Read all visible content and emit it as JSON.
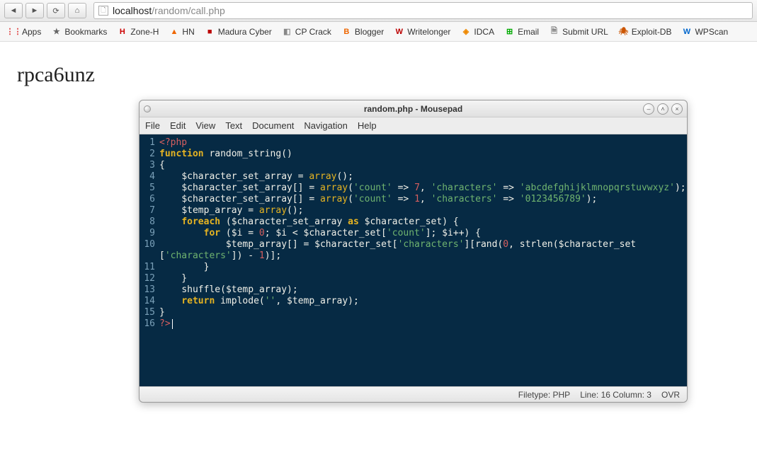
{
  "browser": {
    "nav": {
      "back": "◄",
      "forward": "►",
      "reload": "⟳",
      "home": "⌂",
      "doc": "🗋"
    },
    "url": {
      "host": "localhost",
      "path": "/random/call.php"
    }
  },
  "bookmarks": [
    {
      "icon": "⋮⋮",
      "color": "#d33",
      "label": "Apps"
    },
    {
      "icon": "★",
      "color": "#666",
      "label": "Bookmarks"
    },
    {
      "icon": "H",
      "color": "#c00",
      "label": "Zone-H"
    },
    {
      "icon": "▲",
      "color": "#e60",
      "label": "HN"
    },
    {
      "icon": "■",
      "color": "#b00",
      "label": "Madura Cyber"
    },
    {
      "icon": "◧",
      "color": "#888",
      "label": "CP Crack"
    },
    {
      "icon": "B",
      "color": "#e60",
      "label": "Blogger"
    },
    {
      "icon": "W",
      "color": "#b00",
      "label": "Writelonger"
    },
    {
      "icon": "◈",
      "color": "#e80",
      "label": "IDCA"
    },
    {
      "icon": "⊞",
      "color": "#0a0",
      "label": "Email"
    },
    {
      "icon": "🗎",
      "color": "#888",
      "label": "Submit URL"
    },
    {
      "icon": "🕷",
      "color": "#c50",
      "label": "Exploit-DB"
    },
    {
      "icon": "W",
      "color": "#06c",
      "label": "WPScan"
    }
  ],
  "page": {
    "output": "rpca6unz"
  },
  "editor": {
    "title": "random.php - Mousepad",
    "menu": [
      "File",
      "Edit",
      "View",
      "Text",
      "Document",
      "Navigation",
      "Help"
    ],
    "status": {
      "filetype_label": "Filetype:",
      "filetype": "PHP",
      "pos_label": "Line:",
      "line": "16",
      "col_label": "Column:",
      "col": "3",
      "mode": "OVR"
    },
    "code": [
      [
        [
          "tag",
          "<?php"
        ]
      ],
      [
        [
          "kw",
          "function"
        ],
        [
          "p",
          " "
        ],
        [
          "fn",
          "random_string"
        ],
        [
          "p",
          "()"
        ]
      ],
      [
        [
          "p",
          "{"
        ]
      ],
      [
        [
          "p",
          "    "
        ],
        [
          "var",
          "$character_set_array"
        ],
        [
          "p",
          " "
        ],
        [
          "op",
          "="
        ],
        [
          "p",
          " "
        ],
        [
          "arr",
          "array"
        ],
        [
          "p",
          "();"
        ]
      ],
      [
        [
          "p",
          "    "
        ],
        [
          "var",
          "$character_set_array"
        ],
        [
          "p",
          "[] "
        ],
        [
          "op",
          "="
        ],
        [
          "p",
          " "
        ],
        [
          "arr",
          "array"
        ],
        [
          "p",
          "("
        ],
        [
          "str",
          "'count'"
        ],
        [
          "p",
          " "
        ],
        [
          "op",
          "=>"
        ],
        [
          "p",
          " "
        ],
        [
          "num",
          "7"
        ],
        [
          "p",
          ", "
        ],
        [
          "str",
          "'characters'"
        ],
        [
          "p",
          " "
        ],
        [
          "op",
          "=>"
        ],
        [
          "p",
          " "
        ],
        [
          "str",
          "'abcdefghijklmnopqrstuvwxyz'"
        ],
        [
          "p",
          ");"
        ]
      ],
      [
        [
          "p",
          "    "
        ],
        [
          "var",
          "$character_set_array"
        ],
        [
          "p",
          "[] "
        ],
        [
          "op",
          "="
        ],
        [
          "p",
          " "
        ],
        [
          "arr",
          "array"
        ],
        [
          "p",
          "("
        ],
        [
          "str",
          "'count'"
        ],
        [
          "p",
          " "
        ],
        [
          "op",
          "=>"
        ],
        [
          "p",
          " "
        ],
        [
          "num",
          "1"
        ],
        [
          "p",
          ", "
        ],
        [
          "str",
          "'characters'"
        ],
        [
          "p",
          " "
        ],
        [
          "op",
          "=>"
        ],
        [
          "p",
          " "
        ],
        [
          "str",
          "'0123456789'"
        ],
        [
          "p",
          ");"
        ]
      ],
      [
        [
          "p",
          "    "
        ],
        [
          "var",
          "$temp_array"
        ],
        [
          "p",
          " "
        ],
        [
          "op",
          "="
        ],
        [
          "p",
          " "
        ],
        [
          "arr",
          "array"
        ],
        [
          "p",
          "();"
        ]
      ],
      [
        [
          "p",
          "    "
        ],
        [
          "kw",
          "foreach"
        ],
        [
          "p",
          " ("
        ],
        [
          "var",
          "$character_set_array"
        ],
        [
          "p",
          " "
        ],
        [
          "kw",
          "as"
        ],
        [
          "p",
          " "
        ],
        [
          "var",
          "$character_set"
        ],
        [
          "p",
          ") {"
        ]
      ],
      [
        [
          "p",
          "        "
        ],
        [
          "kw",
          "for"
        ],
        [
          "p",
          " ("
        ],
        [
          "var",
          "$i"
        ],
        [
          "p",
          " "
        ],
        [
          "op",
          "="
        ],
        [
          "p",
          " "
        ],
        [
          "num",
          "0"
        ],
        [
          "p",
          "; "
        ],
        [
          "var",
          "$i"
        ],
        [
          "p",
          " "
        ],
        [
          "op",
          "<"
        ],
        [
          "p",
          " "
        ],
        [
          "var",
          "$character_set"
        ],
        [
          "p",
          "["
        ],
        [
          "str",
          "'count'"
        ],
        [
          "p",
          "]; "
        ],
        [
          "var",
          "$i"
        ],
        [
          "op",
          "++"
        ],
        [
          "p",
          ") {"
        ]
      ],
      [
        [
          "p",
          "            "
        ],
        [
          "var",
          "$temp_array"
        ],
        [
          "p",
          "[] "
        ],
        [
          "op",
          "="
        ],
        [
          "p",
          " "
        ],
        [
          "var",
          "$character_set"
        ],
        [
          "p",
          "["
        ],
        [
          "str",
          "'characters'"
        ],
        [
          "p",
          "]["
        ],
        [
          "fn",
          "rand"
        ],
        [
          "p",
          "("
        ],
        [
          "num",
          "0"
        ],
        [
          "p",
          ", "
        ],
        [
          "fn",
          "strlen"
        ],
        [
          "p",
          "("
        ],
        [
          "var",
          "$character_set"
        ]
      ],
      [
        [
          "p",
          "["
        ],
        [
          "str",
          "'characters'"
        ],
        [
          "p",
          "]) "
        ],
        [
          "op",
          "-"
        ],
        [
          "p",
          " "
        ],
        [
          "num",
          "1"
        ],
        [
          "p",
          ")];"
        ]
      ],
      [
        [
          "p",
          "        }"
        ]
      ],
      [
        [
          "p",
          "    }"
        ]
      ],
      [
        [
          "p",
          "    "
        ],
        [
          "fn",
          "shuffle"
        ],
        [
          "p",
          "("
        ],
        [
          "var",
          "$temp_array"
        ],
        [
          "p",
          ");"
        ]
      ],
      [
        [
          "p",
          "    "
        ],
        [
          "kw",
          "return"
        ],
        [
          "p",
          " "
        ],
        [
          "fn",
          "implode"
        ],
        [
          "p",
          "("
        ],
        [
          "str",
          "''"
        ],
        [
          "p",
          ", "
        ],
        [
          "var",
          "$temp_array"
        ],
        [
          "p",
          ");"
        ]
      ],
      [
        [
          "p",
          "}"
        ]
      ],
      [
        [
          "tag",
          "?>"
        ],
        [
          "cur",
          " "
        ]
      ]
    ],
    "wrap_line": 10
  }
}
